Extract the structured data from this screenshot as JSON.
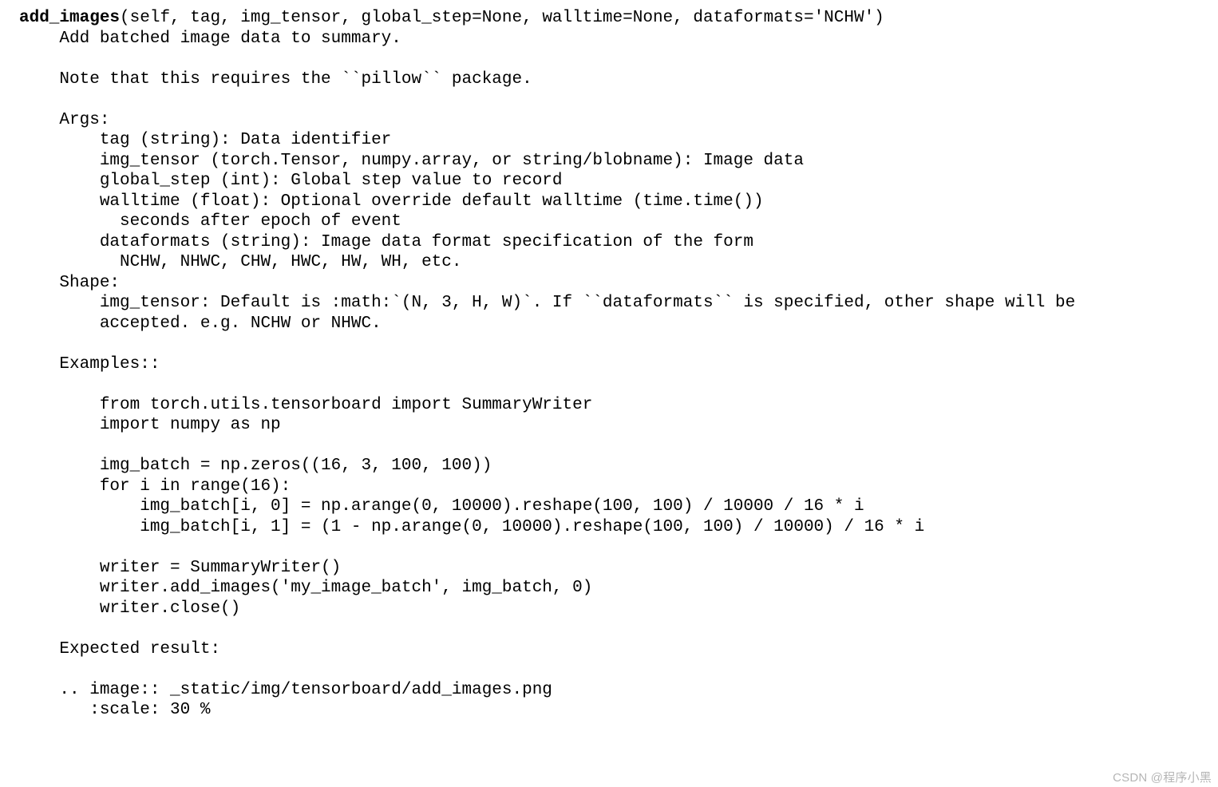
{
  "signature": {
    "name": "add_images",
    "params": "(self, tag, img_tensor, global_step=None, walltime=None, dataformats='NCHW')"
  },
  "docstring": "    Add batched image data to summary.\n\n    Note that this requires the ``pillow`` package.\n\n    Args:\n        tag (string): Data identifier\n        img_tensor (torch.Tensor, numpy.array, or string/blobname): Image data\n        global_step (int): Global step value to record\n        walltime (float): Optional override default walltime (time.time())\n          seconds after epoch of event\n        dataformats (string): Image data format specification of the form\n          NCHW, NHWC, CHW, HWC, HW, WH, etc.\n    Shape:\n        img_tensor: Default is :math:`(N, 3, H, W)`. If ``dataformats`` is specified, other shape will be\n        accepted. e.g. NCHW or NHWC.\n\n    Examples::\n\n        from torch.utils.tensorboard import SummaryWriter\n        import numpy as np\n\n        img_batch = np.zeros((16, 3, 100, 100))\n        for i in range(16):\n            img_batch[i, 0] = np.arange(0, 10000).reshape(100, 100) / 10000 / 16 * i\n            img_batch[i, 1] = (1 - np.arange(0, 10000).reshape(100, 100) / 10000) / 16 * i\n\n        writer = SummaryWriter()\n        writer.add_images('my_image_batch', img_batch, 0)\n        writer.close()\n\n    Expected result:\n\n    .. image:: _static/img/tensorboard/add_images.png\n       :scale: 30 %",
  "watermark": "CSDN @程序小黑"
}
